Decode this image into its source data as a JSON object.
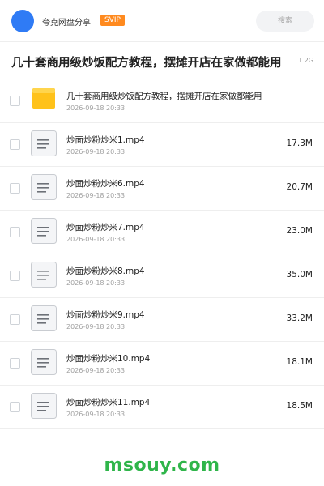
{
  "header": {
    "app_name": "夸克网盘分享",
    "badge": "SVIP",
    "search_placeholder": "搜索"
  },
  "folder": {
    "title": "几十套商用级炒饭配方教程，摆摊开店在家做都能用",
    "size": "1.2G"
  },
  "items": [
    {
      "type": "folder",
      "name": "几十套商用级炒饭配方教程，摆摊开店在家做都能用",
      "date": "2026-09-18 20:33",
      "size": ""
    },
    {
      "type": "file",
      "name": "炒面炒粉炒米1.mp4",
      "date": "2026-09-18 20:33",
      "size": "17.3M"
    },
    {
      "type": "file",
      "name": "炒面炒粉炒米6.mp4",
      "date": "2026-09-18 20:33",
      "size": "20.7M"
    },
    {
      "type": "file",
      "name": "炒面炒粉炒米7.mp4",
      "date": "2026-09-18 20:33",
      "size": "23.0M"
    },
    {
      "type": "file",
      "name": "炒面炒粉炒米8.mp4",
      "date": "2026-09-18 20:33",
      "size": "35.0M"
    },
    {
      "type": "file",
      "name": "炒面炒粉炒米9.mp4",
      "date": "2026-09-18 20:33",
      "size": "33.2M"
    },
    {
      "type": "file",
      "name": "炒面炒粉炒米10.mp4",
      "date": "2026-09-18 20:33",
      "size": "18.1M"
    },
    {
      "type": "file",
      "name": "炒面炒粉炒米11.mp4",
      "date": "2026-09-18 20:33",
      "size": "18.5M"
    }
  ],
  "watermark": "msouy.com",
  "colors": {
    "avatar": "#2f7bf5",
    "svip_badge": "#ff8a1f",
    "folder_icon": "#ffc21a",
    "watermark": "#2fb54a"
  },
  "icons": {
    "folder": "folder-icon",
    "file": "file-icon"
  }
}
